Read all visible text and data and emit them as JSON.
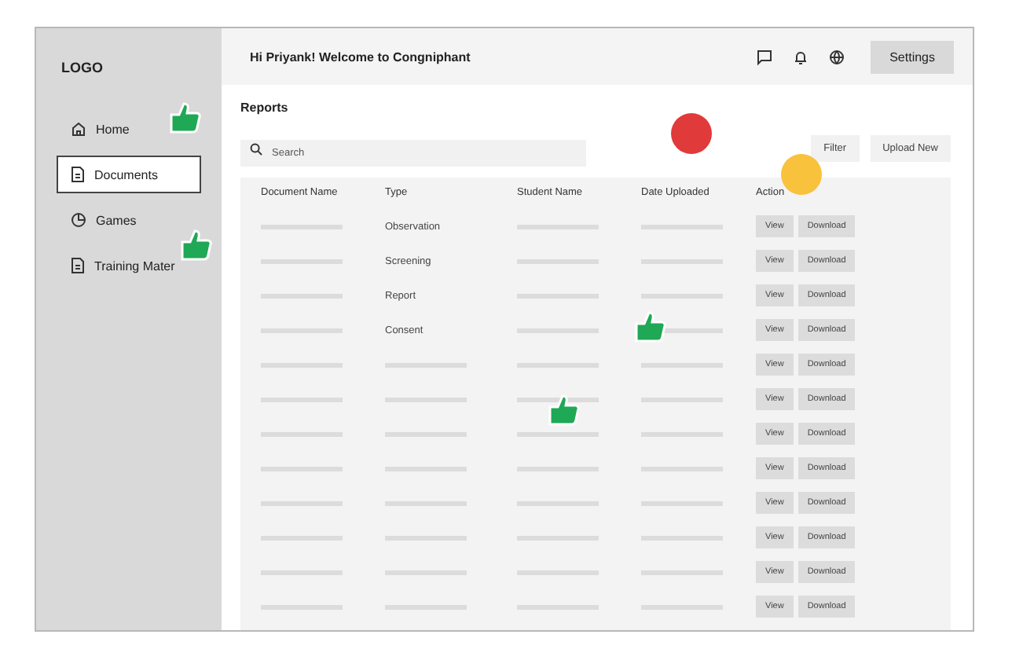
{
  "sidebar": {
    "logo": "LOGO",
    "items": [
      {
        "label": "Home",
        "selected": false
      },
      {
        "label": "Documents",
        "selected": true
      },
      {
        "label": "Games",
        "selected": false
      },
      {
        "label": "Training Mater",
        "selected": false
      }
    ]
  },
  "header": {
    "greeting": "Hi Priyank! Welcome to Congniphant",
    "settings_button": "Settings"
  },
  "page_title": "Reports",
  "search": {
    "placeholder": "Search"
  },
  "buttons": [
    "Filter",
    "Upload New"
  ],
  "table": {
    "columns": [
      "Document Name",
      "Type",
      "Student Name",
      "Date Uploaded",
      "Action"
    ],
    "rows": [
      {
        "type": "Observation",
        "actions": [
          "View",
          "Download"
        ]
      },
      {
        "type": "Screening",
        "actions": [
          "View",
          "Download"
        ]
      },
      {
        "type": "Report",
        "actions": [
          "View",
          "Download"
        ]
      },
      {
        "type": "Consent",
        "actions": [
          "View",
          "Download"
        ]
      },
      {
        "actions": [
          "View",
          "Download"
        ]
      },
      {
        "actions": [
          "View",
          "Download"
        ]
      },
      {
        "actions": [
          "View",
          "Download"
        ]
      },
      {
        "actions": [
          "View",
          "Download"
        ]
      },
      {
        "actions": [
          "View",
          "Download"
        ]
      },
      {
        "actions": [
          "View",
          "Download"
        ]
      },
      {
        "actions": [
          "View",
          "Download"
        ]
      },
      {
        "actions": [
          "View",
          "Download"
        ]
      }
    ]
  },
  "stickers": [
    {
      "kind": "thumb"
    },
    {
      "kind": "thumb"
    },
    {
      "kind": "thumb"
    },
    {
      "kind": "thumb"
    },
    {
      "kind": "dot",
      "color": "#e03a3a"
    },
    {
      "kind": "dot",
      "color": "#f9c23c"
    }
  ]
}
